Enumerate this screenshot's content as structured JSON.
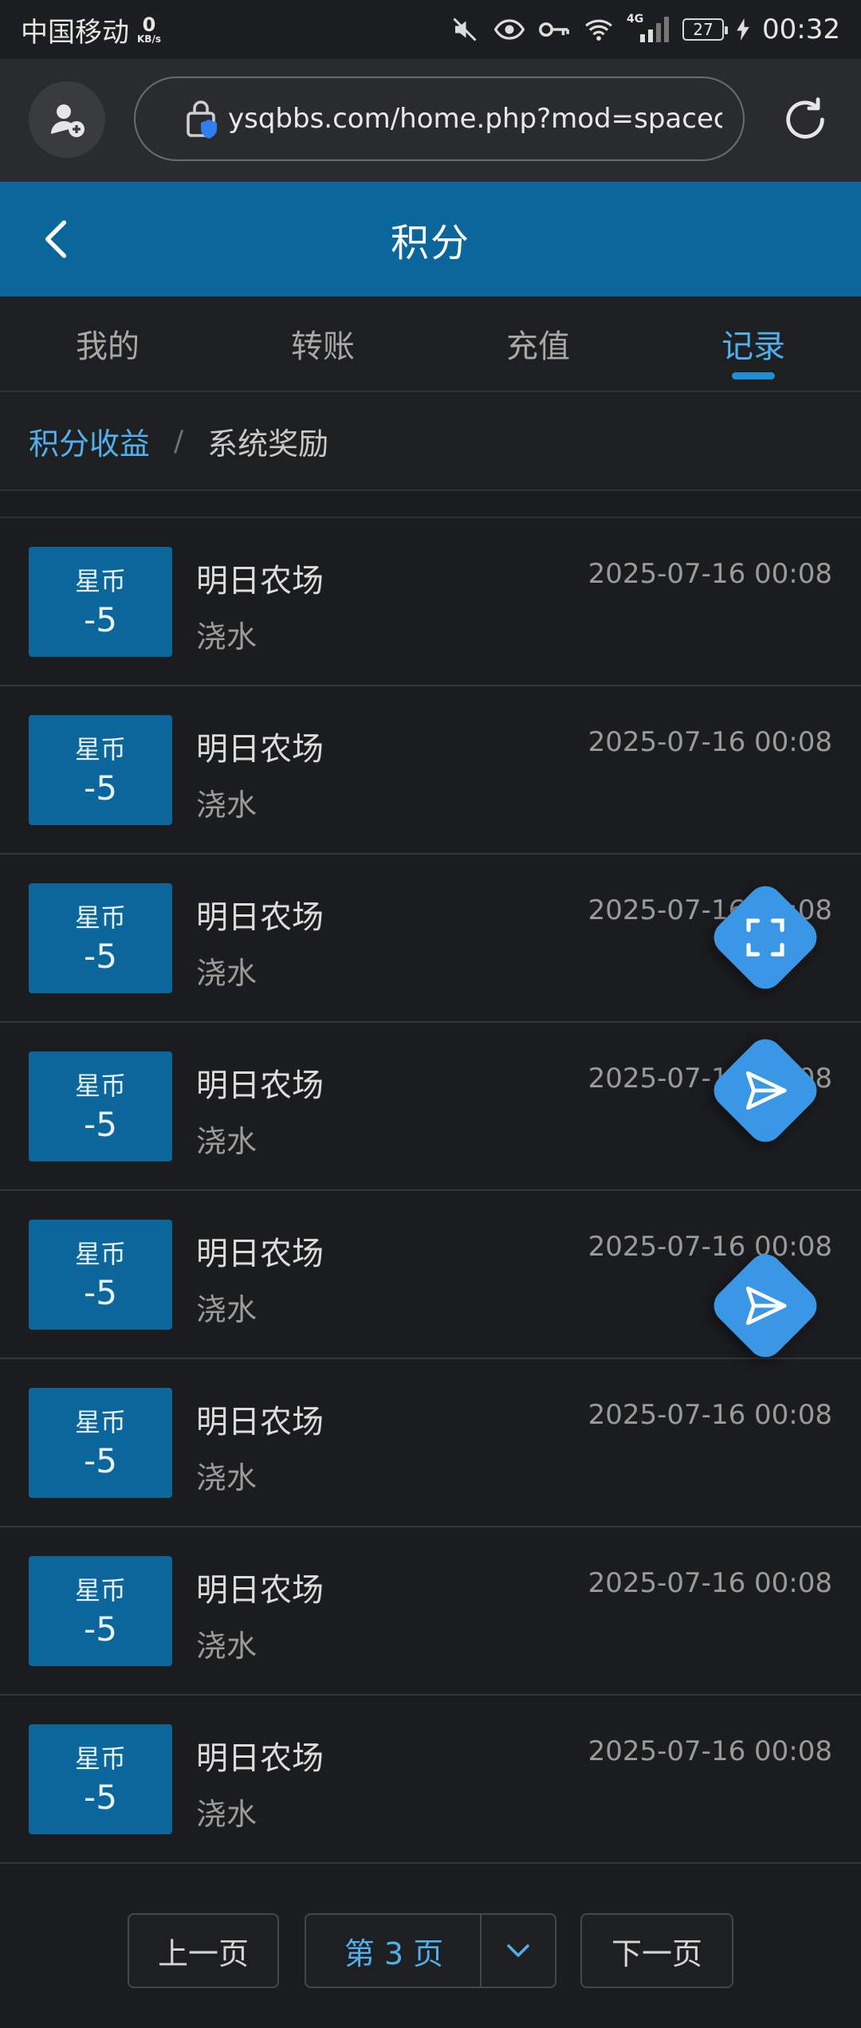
{
  "statusbar": {
    "carrier": "中国移动",
    "speed_value": "0",
    "speed_unit": "KB/s",
    "network": "4G",
    "battery": "27",
    "time": "00:32"
  },
  "browser": {
    "url": "ysqbbs.com/home.php?mod=spacecp"
  },
  "header": {
    "title": "积分"
  },
  "tabs": [
    {
      "label": "我的"
    },
    {
      "label": "转账"
    },
    {
      "label": "充值"
    },
    {
      "label": "记录"
    }
  ],
  "breadcrumb": {
    "link": "积分收益",
    "separator": "/",
    "current": "系统奖励"
  },
  "records": [
    {
      "currency": "星币",
      "amount": "-5",
      "title": "明日农场",
      "action": "浇水",
      "time": "2025-07-16 00:08"
    },
    {
      "currency": "星币",
      "amount": "-5",
      "title": "明日农场",
      "action": "浇水",
      "time": "2025-07-16 00:08"
    },
    {
      "currency": "星币",
      "amount": "-5",
      "title": "明日农场",
      "action": "浇水",
      "time": "2025-07-16 00:08"
    },
    {
      "currency": "星币",
      "amount": "-5",
      "title": "明日农场",
      "action": "浇水",
      "time": "2025-07-16 00:08"
    },
    {
      "currency": "星币",
      "amount": "-5",
      "title": "明日农场",
      "action": "浇水",
      "time": "2025-07-16 00:08"
    },
    {
      "currency": "星币",
      "amount": "-5",
      "title": "明日农场",
      "action": "浇水",
      "time": "2025-07-16 00:08"
    },
    {
      "currency": "星币",
      "amount": "-5",
      "title": "明日农场",
      "action": "浇水",
      "time": "2025-07-16 00:08"
    },
    {
      "currency": "星币",
      "amount": "-5",
      "title": "明日农场",
      "action": "浇水",
      "time": "2025-07-16 00:08"
    }
  ],
  "pager": {
    "prev": "上一页",
    "current": "第 3 页",
    "next": "下一页"
  },
  "colors": {
    "accent": "#0b679b",
    "link": "#4fb0ec",
    "fab": "#3a97e6"
  }
}
